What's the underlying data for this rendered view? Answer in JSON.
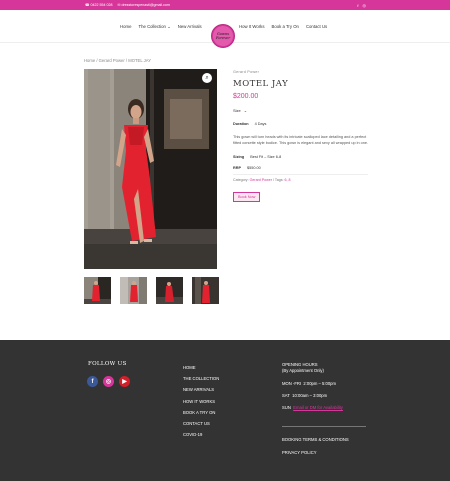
{
  "topbar": {
    "phone": "0422 554 028",
    "email": "dresstorespenasti@gmail.com"
  },
  "header": {
    "nav_left": [
      "Home",
      "The Collection",
      "New Arrivals"
    ],
    "nav_right": [
      "How It Works",
      "Book a Try On",
      "Contact Us"
    ],
    "logo_text_line1": "Gowns",
    "logo_text_line2": "Forever"
  },
  "breadcrumb": {
    "home": "Home",
    "sep": " / ",
    "category": "Gerard Power",
    "current": "MOTEL JAY"
  },
  "product": {
    "category_label": "Gerard Power",
    "title": "MOTEL JAY",
    "price": "$200.00",
    "size_label": "Size",
    "duration_label": "Duration",
    "duration_value": "4 Days",
    "description": "This gown will turn heads with its intricate scalloped lace detailing and a perfect fitted corsette style bodice. This gown is elegant and sexy all wrapped up in one.",
    "sizing_label": "Sizing",
    "sizing_value": "Best Fit – Size 6-8",
    "rrp_label": "RRP",
    "rrp_value": "$550.00",
    "category_prefix": "Category: ",
    "category_link": "Gerard Power",
    "tags_prefix": " / Tags: ",
    "tags_value": "6, 8",
    "book_button": "Book Now"
  },
  "footer": {
    "follow_title": "FOLLOW US",
    "social": [
      "f",
      "ig",
      "yt"
    ],
    "links": [
      "HOME",
      "THE COLLECTION",
      "NEW ARRIVALS",
      "HOW IT WORKS",
      "BOOK A TRY ON",
      "CONTACT US",
      "COVID-19"
    ],
    "hours_title": "OPENING HOURS",
    "hours_note": "(By Appointment Only)",
    "weekday_label": "MON -FRI",
    "weekday_hours": "2:00pm – 5:00pm",
    "sat_label": "SAT",
    "sat_hours": "10:00am – 3:00pm",
    "sun_label": "SUN",
    "sun_link": "Email or DM for Availability",
    "booking_terms": "BOOKING TERMS & CONDITIONS",
    "privacy": "PRIVACY POLICY"
  },
  "colors": {
    "brand": "#d6369a",
    "footer_bg": "#333333"
  }
}
